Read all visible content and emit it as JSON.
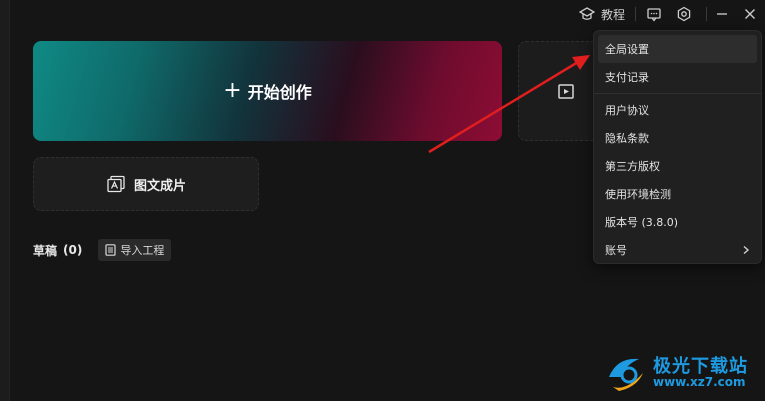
{
  "titlebar": {
    "tutorial_label": "教程"
  },
  "home": {
    "start_create_label": "开始创作",
    "text_to_video_label": "图文成片",
    "drafts_title": "草稿",
    "drafts_count": "(0)",
    "import_project_label": "导入工程"
  },
  "menu": {
    "items": [
      {
        "label": "全局设置"
      },
      {
        "label": "支付记录"
      },
      {
        "label": "用户协议"
      },
      {
        "label": "隐私条款"
      },
      {
        "label": "第三方版权"
      },
      {
        "label": "使用环境检测"
      },
      {
        "label": "版本号 (3.8.0)"
      },
      {
        "label": "账号"
      }
    ]
  },
  "watermark": {
    "title": "极光下载站",
    "url": "www.xz7.com"
  },
  "colors": {
    "accent_arrow": "#e01e1e",
    "gradient_start": "#0f8a85",
    "gradient_end": "#8d0c34",
    "watermark_blue": "#1d9ae0"
  }
}
